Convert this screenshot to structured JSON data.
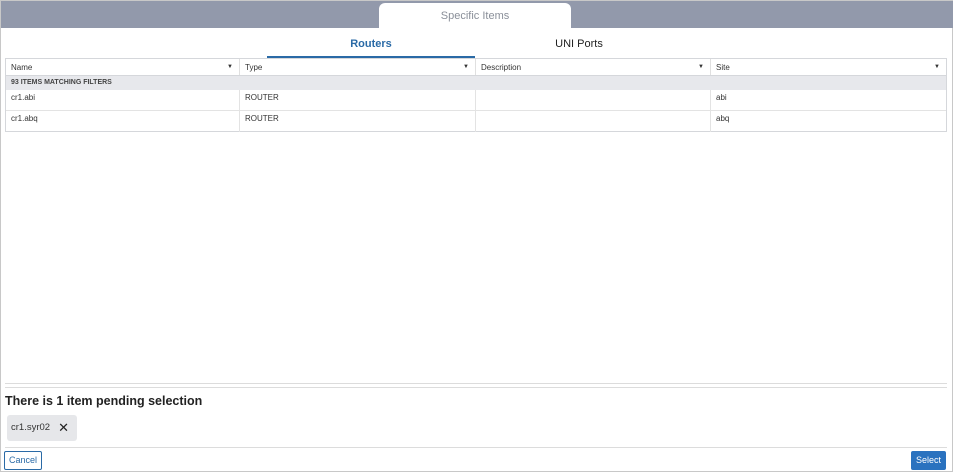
{
  "dialog": {
    "title": "Specific Items"
  },
  "tabs": [
    {
      "label": "Routers"
    },
    {
      "label": "UNI Ports"
    }
  ],
  "grid": {
    "columns": [
      {
        "label": "Name"
      },
      {
        "label": "Type"
      },
      {
        "label": "Description"
      },
      {
        "label": "Site"
      }
    ],
    "group_label": "93 ITEMS MATCHING FILTERS",
    "rows": [
      {
        "name": "cr1.abi",
        "type": "ROUTER",
        "description": "",
        "site": "abi"
      },
      {
        "name": "cr1.abq",
        "type": "ROUTER",
        "description": "",
        "site": "abq"
      }
    ]
  },
  "pending": {
    "text": "There is 1 item pending selection",
    "chips": [
      {
        "label": "cr1.syr02"
      }
    ]
  },
  "footer": {
    "cancel": "Cancel",
    "select": "Select"
  }
}
